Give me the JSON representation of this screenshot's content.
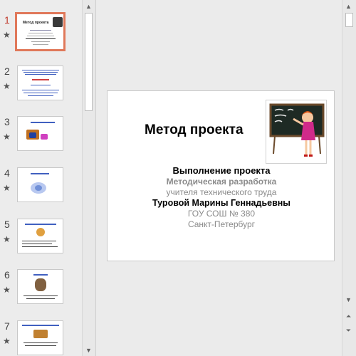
{
  "thumbnails": [
    {
      "number": "1",
      "title": "Метод проекта",
      "active": true
    },
    {
      "number": "2",
      "title": "",
      "active": false
    },
    {
      "number": "3",
      "title": "",
      "active": false
    },
    {
      "number": "4",
      "title": "",
      "active": false
    },
    {
      "number": "5",
      "title": "",
      "active": false
    },
    {
      "number": "6",
      "title": "",
      "active": false
    },
    {
      "number": "7",
      "title": "",
      "active": false
    }
  ],
  "star_icon": "★",
  "slide": {
    "title": "Метод проекта",
    "line1": "Выполнение проекта",
    "line2": "Методическая разработка",
    "line3": "учителя технического труда",
    "line4": "Туровой Марины Геннадьевны",
    "line5": "ГОУ СОШ № 380",
    "line6": "Санкт-Петербург"
  },
  "icons": {
    "scroll_up": "scroll-up-arrow",
    "scroll_down": "scroll-down-arrow",
    "prev_slide": "previous-slide-icon",
    "next_slide": "next-slide-icon"
  }
}
